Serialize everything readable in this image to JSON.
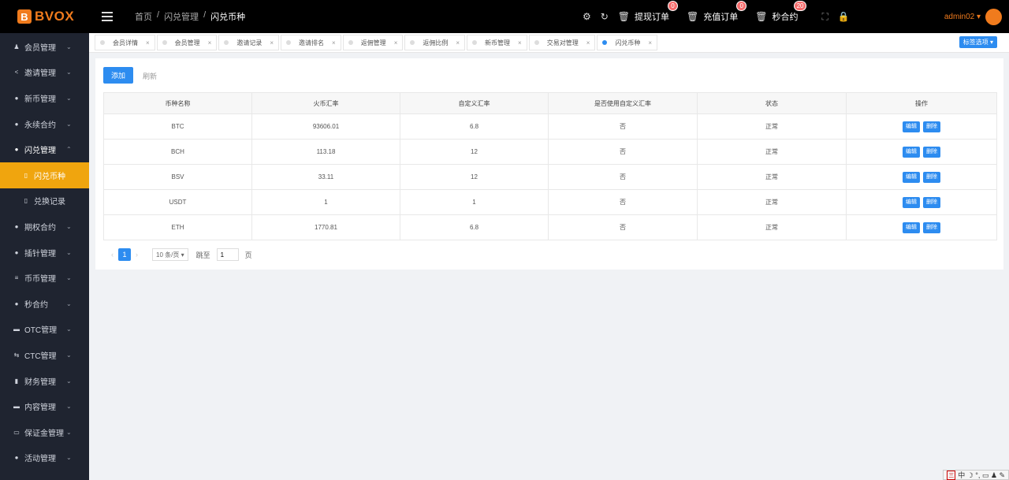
{
  "brand": {
    "logo_letter": "B",
    "name": "BVOX"
  },
  "breadcrumb": [
    "首页",
    "/",
    "闪兑管理",
    "/",
    "闪兑币种"
  ],
  "header": {
    "withdraw_label": "提现订单",
    "withdraw_count": "0",
    "recharge_label": "充值订单",
    "recharge_count": "0",
    "second_label": "秒合约",
    "second_count": "20",
    "user": "admin02 ▾"
  },
  "sidebar": {
    "items": [
      {
        "icon": "♟",
        "label": "会员管理",
        "chev": "⌄"
      },
      {
        "icon": "<",
        "label": "邀请管理",
        "chev": "⌄"
      },
      {
        "icon": "●",
        "label": "新币管理",
        "chev": "⌄"
      },
      {
        "icon": "●",
        "label": "永续合约",
        "chev": "⌄"
      },
      {
        "icon": "●",
        "label": "闪兑管理",
        "chev": "⌃"
      },
      {
        "icon": "▯",
        "label": "闪兑币种",
        "chev": ""
      },
      {
        "icon": "▯",
        "label": "兑换记录",
        "chev": ""
      },
      {
        "icon": "●",
        "label": "期权合约",
        "chev": "⌄"
      },
      {
        "icon": "●",
        "label": "插针管理",
        "chev": "⌄"
      },
      {
        "icon": "≡",
        "label": "币币管理",
        "chev": "⌄"
      },
      {
        "icon": "●",
        "label": "秒合约",
        "chev": "⌄"
      },
      {
        "icon": "▬",
        "label": "OTC管理",
        "chev": "⌄"
      },
      {
        "icon": "⇆",
        "label": "CTC管理",
        "chev": "⌄"
      },
      {
        "icon": "▮",
        "label": "财务管理",
        "chev": "⌄"
      },
      {
        "icon": "▬",
        "label": "内容管理",
        "chev": "⌄"
      },
      {
        "icon": "▭",
        "label": "保证金管理",
        "chev": "⌄"
      },
      {
        "icon": "●",
        "label": "活动管理",
        "chev": "⌄"
      }
    ]
  },
  "tabs": [
    "会员详情",
    "会员管理",
    "邀请记录",
    "邀请排名",
    "返佣管理",
    "返佣比例",
    "新币管理",
    "交易对管理",
    "闪兑币种"
  ],
  "tab_close": "×",
  "tab_options": "标签选项 ▾",
  "toolbar": {
    "add_label": "添加",
    "refresh_label": "刷新"
  },
  "table": {
    "headers": [
      "币种名称",
      "火币汇率",
      "自定义汇率",
      "是否使用自定义汇率",
      "状态",
      "操作"
    ],
    "rows": [
      [
        "BTC",
        "93606.01",
        "6.8",
        "否",
        "正常"
      ],
      [
        "BCH",
        "113.18",
        "12",
        "否",
        "正常"
      ],
      [
        "BSV",
        "33.11",
        "12",
        "否",
        "正常"
      ],
      [
        "USDT",
        "1",
        "1",
        "否",
        "正常"
      ],
      [
        "ETH",
        "1770.81",
        "6.8",
        "否",
        "正常"
      ]
    ],
    "edit_label": "编辑",
    "delete_label": "删除"
  },
  "pager": {
    "prev": "‹",
    "current": "1",
    "next": "›",
    "size": "10 条/页 ▾",
    "jump_label": "跳至",
    "jump_value": "1",
    "page_unit": "页"
  },
  "tray": "中 ☽ °, ▭ ♟ ✎",
  "tray_logo": "三"
}
